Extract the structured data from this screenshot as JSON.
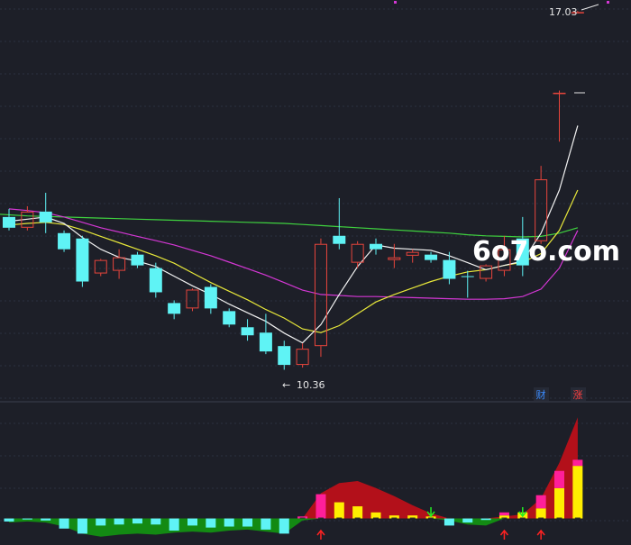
{
  "watermark": "6o7o.com",
  "labels": {
    "high_price": "17.03",
    "low_price": "10.36",
    "low_arrow": "←",
    "badge_finance": "财",
    "badge_rise": "涨"
  },
  "colors": {
    "background": "#1d1f28",
    "grid": "#2c3140",
    "separator": "#3a3f4e",
    "up_candle": "#e8453c",
    "down_candle": "#5ff3f5",
    "ma_white": "#f2f2f2",
    "ma_yellow": "#e8e83a",
    "ma_magenta": "#d437d4",
    "ma_green": "#3fd23f",
    "bar_magenta": "#ff1f9a",
    "bar_yellow": "#ffee00",
    "area_red": "#b3101a",
    "area_green": "#138a13",
    "arrow_red": "#ff2222",
    "arrow_green": "#22ee22",
    "badge_blue": "#3b8cff",
    "badge_red": "#ff4040"
  },
  "chart_data": {
    "type": "candlestick",
    "candles": [
      {
        "o": 13.2,
        "c": 13.0,
        "h": 13.35,
        "l": 12.95
      },
      {
        "o": 13.0,
        "c": 13.3,
        "h": 13.4,
        "l": 12.95
      },
      {
        "o": 13.3,
        "c": 13.1,
        "h": 13.65,
        "l": 12.9
      },
      {
        "o": 12.9,
        "c": 12.6,
        "h": 12.95,
        "l": 12.55
      },
      {
        "o": 12.8,
        "c": 12.0,
        "h": 12.85,
        "l": 11.9
      },
      {
        "o": 12.15,
        "c": 12.4,
        "h": 12.42,
        "l": 12.1
      },
      {
        "o": 12.2,
        "c": 12.45,
        "h": 12.6,
        "l": 12.05
      },
      {
        "o": 12.5,
        "c": 12.3,
        "h": 12.55,
        "l": 12.25
      },
      {
        "o": 12.25,
        "c": 11.8,
        "h": 12.35,
        "l": 11.7
      },
      {
        "o": 11.6,
        "c": 11.4,
        "h": 11.65,
        "l": 11.3
      },
      {
        "o": 11.5,
        "c": 11.85,
        "h": 11.87,
        "l": 11.45
      },
      {
        "o": 11.9,
        "c": 11.5,
        "h": 11.95,
        "l": 11.4
      },
      {
        "o": 11.45,
        "c": 11.2,
        "h": 11.5,
        "l": 11.15
      },
      {
        "o": 11.15,
        "c": 11.0,
        "h": 11.3,
        "l": 10.9
      },
      {
        "o": 11.05,
        "c": 10.7,
        "h": 11.4,
        "l": 10.65
      },
      {
        "o": 10.8,
        "c": 10.45,
        "h": 10.9,
        "l": 10.36
      },
      {
        "o": 10.45,
        "c": 10.75,
        "h": 10.85,
        "l": 10.4
      },
      {
        "o": 10.8,
        "c": 12.7,
        "h": 12.8,
        "l": 10.6
      },
      {
        "o": 12.85,
        "c": 12.7,
        "h": 13.55,
        "l": 12.6
      },
      {
        "o": 12.35,
        "c": 12.7,
        "h": 12.75,
        "l": 12.25
      },
      {
        "o": 12.7,
        "c": 12.6,
        "h": 12.8,
        "l": 12.5
      },
      {
        "o": 12.4,
        "c": 12.45,
        "h": 12.7,
        "l": 12.25
      },
      {
        "o": 12.48,
        "c": 12.55,
        "h": 12.6,
        "l": 12.35
      },
      {
        "o": 12.5,
        "c": 12.4,
        "h": 12.55,
        "l": 12.35
      },
      {
        "o": 12.4,
        "c": 12.05,
        "h": 12.55,
        "l": 11.95
      },
      {
        "o": 12.1,
        "c": 12.09,
        "h": 12.2,
        "l": 11.7
      },
      {
        "o": 12.05,
        "c": 12.3,
        "h": 12.32,
        "l": 12.0
      },
      {
        "o": 12.2,
        "c": 12.6,
        "h": 12.85,
        "l": 12.1
      },
      {
        "o": 12.8,
        "c": 12.3,
        "h": 13.2,
        "l": 12.1
      },
      {
        "o": 12.75,
        "c": 13.9,
        "h": 14.15,
        "l": 12.7
      },
      {
        "o": 15.5,
        "c": 15.51,
        "h": 15.55,
        "l": 14.6
      },
      {
        "o": 17.0,
        "c": 17.01,
        "h": 17.03,
        "l": 16.99
      }
    ],
    "ma_lines": [
      {
        "color": "white",
        "values": [
          13.12,
          13.16,
          13.2,
          13.08,
          12.82,
          12.6,
          12.45,
          12.38,
          12.28,
          12.1,
          11.92,
          11.76,
          11.58,
          11.42,
          11.26,
          11.04,
          10.86,
          11.2,
          11.76,
          12.28,
          12.68,
          12.62,
          12.6,
          12.58,
          12.48,
          12.35,
          12.22,
          12.3,
          12.38,
          12.9,
          13.7,
          14.9
        ]
      },
      {
        "color": "yellow",
        "values": [
          13.05,
          13.08,
          13.1,
          13.06,
          12.96,
          12.84,
          12.72,
          12.6,
          12.48,
          12.34,
          12.16,
          11.98,
          11.82,
          11.66,
          11.48,
          11.32,
          11.12,
          11.05,
          11.18,
          11.4,
          11.62,
          11.76,
          11.88,
          12.0,
          12.1,
          12.18,
          12.22,
          12.3,
          12.36,
          12.52,
          12.95,
          13.7
        ]
      },
      {
        "color": "magenta",
        "values": [
          13.35,
          13.32,
          13.28,
          13.2,
          13.1,
          13.0,
          12.92,
          12.84,
          12.76,
          12.68,
          12.58,
          12.48,
          12.36,
          12.24,
          12.12,
          11.98,
          11.84,
          11.76,
          11.74,
          11.72,
          11.72,
          11.71,
          11.7,
          11.69,
          11.68,
          11.67,
          11.67,
          11.68,
          11.72,
          11.86,
          12.25,
          12.95
        ]
      },
      {
        "color": "green",
        "values": [
          13.25,
          13.22,
          13.21,
          13.2,
          13.19,
          13.18,
          13.17,
          13.16,
          13.15,
          13.14,
          13.13,
          13.12,
          13.11,
          13.1,
          13.09,
          13.08,
          13.06,
          13.04,
          13.02,
          13.0,
          12.98,
          12.96,
          12.94,
          12.92,
          12.9,
          12.87,
          12.85,
          12.84,
          12.83,
          12.84,
          12.9,
          13.0
        ]
      }
    ],
    "high_label": 17.03,
    "low_label": 10.36,
    "indicator": {
      "bars": [
        -0.3,
        -0.1,
        -0.2,
        -1.0,
        -1.5,
        -0.7,
        -0.6,
        -0.5,
        -0.6,
        -1.2,
        -0.7,
        -0.9,
        -0.8,
        -0.8,
        -1.1,
        -1.5,
        0.2,
        2.4,
        1.6,
        1.2,
        0.6,
        0.3,
        0.3,
        0.2,
        -0.7,
        -0.4,
        -0.15,
        0.6,
        0.6,
        2.3,
        4.7,
        5.8
      ],
      "bar_magenta_part": [
        0,
        0,
        0,
        0,
        0,
        0,
        0,
        0,
        0,
        0,
        0.2,
        0,
        0,
        0,
        0,
        0,
        0.2,
        2.4,
        0,
        0,
        0,
        0,
        0,
        0,
        0,
        0,
        0,
        0.3,
        0,
        1.3,
        1.7,
        0.6
      ],
      "area": [
        -0.4,
        -0.3,
        -0.4,
        -0.8,
        -1.5,
        -1.8,
        -1.6,
        -1.5,
        -1.6,
        -1.4,
        -1.3,
        -1.4,
        -1.2,
        -1.1,
        -1.3,
        -1.5,
        -0.2,
        2.5,
        3.5,
        3.7,
        3.0,
        2.2,
        1.3,
        0.5,
        -0.2,
        -0.6,
        -0.7,
        0.2,
        0.4,
        2.0,
        5.5,
        10.0
      ],
      "signals": [
        {
          "index": 17,
          "direction": "up",
          "color": "red"
        },
        {
          "index": 23,
          "direction": "down",
          "color": "green"
        },
        {
          "index": 27,
          "direction": "up",
          "color": "red"
        },
        {
          "index": 28,
          "direction": "down",
          "color": "green"
        },
        {
          "index": 29,
          "direction": "up",
          "color": "red"
        }
      ],
      "ylim": [
        -2,
        11
      ]
    },
    "ylim": [
      10.2,
      17.1
    ]
  }
}
